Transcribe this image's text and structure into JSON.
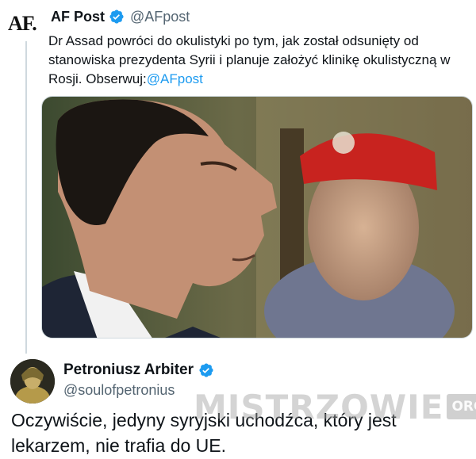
{
  "tweet1": {
    "logo": "AF.",
    "name": "AF Post",
    "handle": "@AFpost",
    "text": "Dr Assad powróci do okulistyki po tym, jak został odsunięty od stanowiska prezydenta Syrii i planuje założyć klinikę okulistyczną w Rosji. Obserwuj:",
    "mention": "@AFpost",
    "image_icon": "photo-image"
  },
  "tweet2": {
    "name": "Petroniusz Arbiter",
    "handle": "@soulofpetronius",
    "text": "Oczywiście, jedyny syryjski uchodźca, który jest lekarzem, nie trafia do UE."
  },
  "watermark": {
    "text": "MISTRZOWIE",
    "suffix": "ORG"
  },
  "colors": {
    "verified": "#1d9bf0",
    "handle": "#536471",
    "link": "#1d9bf0",
    "text": "#0f1419"
  }
}
